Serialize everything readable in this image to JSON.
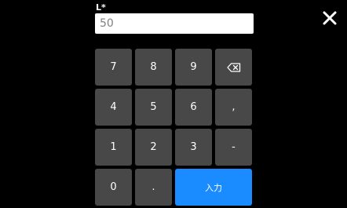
{
  "field": {
    "label": "L*",
    "value": "50"
  },
  "close": {
    "icon": "close-icon"
  },
  "keypad": {
    "keys": [
      {
        "label": "7",
        "name": "key-7"
      },
      {
        "label": "8",
        "name": "key-8"
      },
      {
        "label": "9",
        "name": "key-9"
      },
      {
        "label": "",
        "name": "backspace-key",
        "icon": "backspace-icon"
      },
      {
        "label": "4",
        "name": "key-4"
      },
      {
        "label": "5",
        "name": "key-5"
      },
      {
        "label": "6",
        "name": "key-6"
      },
      {
        "label": ",",
        "name": "key-comma"
      },
      {
        "label": "1",
        "name": "key-1"
      },
      {
        "label": "2",
        "name": "key-2"
      },
      {
        "label": "3",
        "name": "key-3"
      },
      {
        "label": "-",
        "name": "key-minus"
      },
      {
        "label": "0",
        "name": "key-0"
      },
      {
        "label": ".",
        "name": "key-decimal-point"
      },
      {
        "label": "入力",
        "name": "enter-button",
        "accent": "#1a8cff"
      }
    ]
  },
  "colors": {
    "background": "#000000",
    "key": "#484848",
    "accent": "#1a8cff"
  }
}
